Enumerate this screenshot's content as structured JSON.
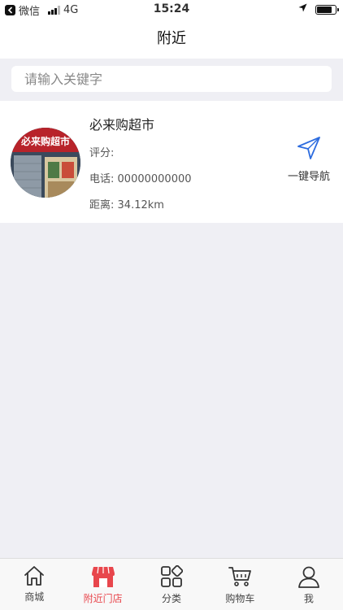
{
  "status_bar": {
    "carrier": "微信",
    "network": "4G",
    "time": "15:24"
  },
  "nav": {
    "title": "附近"
  },
  "search": {
    "placeholder": "请输入关键字"
  },
  "store": {
    "name": "必来购超市",
    "rating_label": "评分:",
    "phone_label": "电话:",
    "phone": "00000000000",
    "distance_label": "距离:",
    "distance": "34.12km",
    "photo_sign": "必来购超市",
    "navigate_label": "一键导航"
  },
  "tab_bar": {
    "items": [
      {
        "label": "商城",
        "icon": "home-icon",
        "active": false
      },
      {
        "label": "附近门店",
        "icon": "store-icon",
        "active": true
      },
      {
        "label": "分类",
        "icon": "category-icon",
        "active": false
      },
      {
        "label": "购物车",
        "icon": "cart-icon",
        "active": false
      },
      {
        "label": "我",
        "icon": "profile-icon",
        "active": false
      }
    ]
  },
  "colors": {
    "accent": "#e8464c",
    "page_background": "#efeff4"
  }
}
